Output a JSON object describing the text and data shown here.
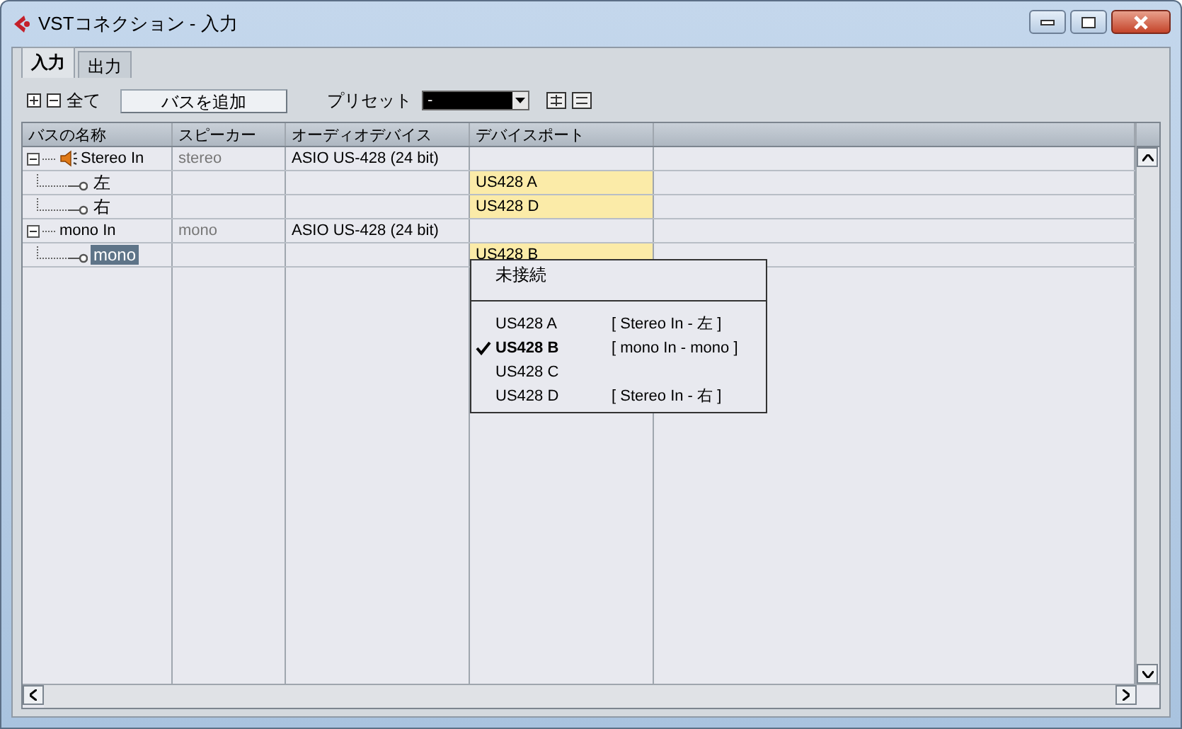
{
  "window": {
    "title": "VSTコネクション - 入力"
  },
  "tabs": [
    {
      "label": "入力",
      "selected": true
    },
    {
      "label": "出力",
      "selected": false
    }
  ],
  "toolbar": {
    "all_label": "全て",
    "add_button": "バスを追加",
    "preset_label": "プリセット",
    "preset_value": "-"
  },
  "table": {
    "columns": [
      "バスの名称",
      "スピーカー",
      "オーディオデバイス",
      "デバイスポート"
    ],
    "rows": [
      {
        "name": "Stereo In",
        "main": true,
        "expanded": true,
        "speaker": "stereo",
        "device": "ASIO US-428 (24 bit)",
        "children": [
          {
            "name": "左",
            "selected": false,
            "port": "US428 A"
          },
          {
            "name": "右",
            "selected": false,
            "port": "US428 D"
          }
        ]
      },
      {
        "name": "mono In",
        "main": false,
        "expanded": true,
        "speaker": "mono",
        "device": "ASIO US-428 (24 bit)",
        "children": [
          {
            "name": "mono",
            "selected": true,
            "port": "US428 B"
          }
        ]
      }
    ]
  },
  "port_menu": {
    "items": [
      {
        "kind": "plain",
        "label": "未接続"
      },
      {
        "kind": "separator"
      },
      {
        "kind": "port",
        "label": "US428 A",
        "checked": false,
        "connection": "[ Stereo In - 左 ]"
      },
      {
        "kind": "port",
        "label": "US428 B",
        "checked": true,
        "connection": "[ mono In - mono ]"
      },
      {
        "kind": "port",
        "label": "US428 C",
        "checked": false
      },
      {
        "kind": "port",
        "label": "US428 D",
        "checked": false,
        "connection": "[ Stereo In - 右 ]"
      }
    ]
  }
}
